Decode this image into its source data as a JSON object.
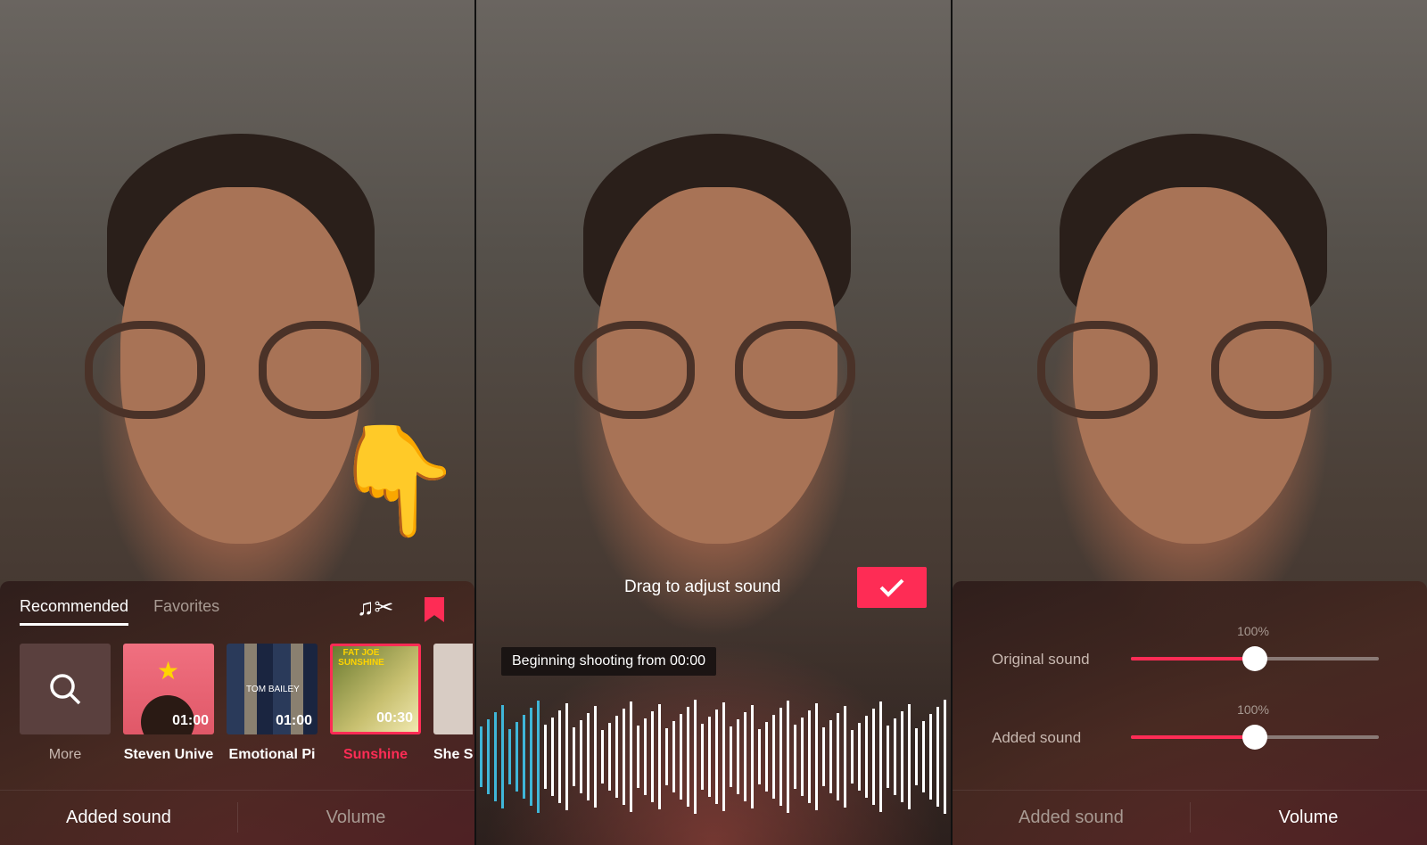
{
  "panel1": {
    "tabs": [
      {
        "label": "Recommended",
        "active": true
      },
      {
        "label": "Favorites",
        "active": false
      }
    ],
    "icons": [
      "music-cut-icon",
      "bookmark-icon"
    ],
    "cards": [
      {
        "label": "More",
        "icon": "search-icon"
      },
      {
        "label": "Steven Unive",
        "duration": "01:00"
      },
      {
        "label": "Emotional Pi",
        "duration": "01:00",
        "cover_text": "TOM BAILEY"
      },
      {
        "label": "Sunshine",
        "duration": "00:30",
        "selected": true,
        "cover_text": "FAT JOE SUNSHINE"
      },
      {
        "label": "She S"
      }
    ],
    "bottom_tabs": [
      {
        "label": "Added sound",
        "active": true
      },
      {
        "label": "Volume",
        "active": false
      }
    ]
  },
  "panel2": {
    "hint": "Drag to adjust sound",
    "confirm_icon": "check-icon",
    "tooltip": "Beginning shooting from 00:00"
  },
  "panel3": {
    "sliders": [
      {
        "label": "Original sound",
        "value_text": "100%",
        "fraction": 0.5
      },
      {
        "label": "Added sound",
        "value_text": "100%",
        "fraction": 0.5
      }
    ],
    "bottom_tabs": [
      {
        "label": "Added sound",
        "active": false
      },
      {
        "label": "Volume",
        "active": true
      }
    ]
  },
  "colors": {
    "accent": "#fe2c55",
    "waveform_played": "#3fb6d8"
  }
}
